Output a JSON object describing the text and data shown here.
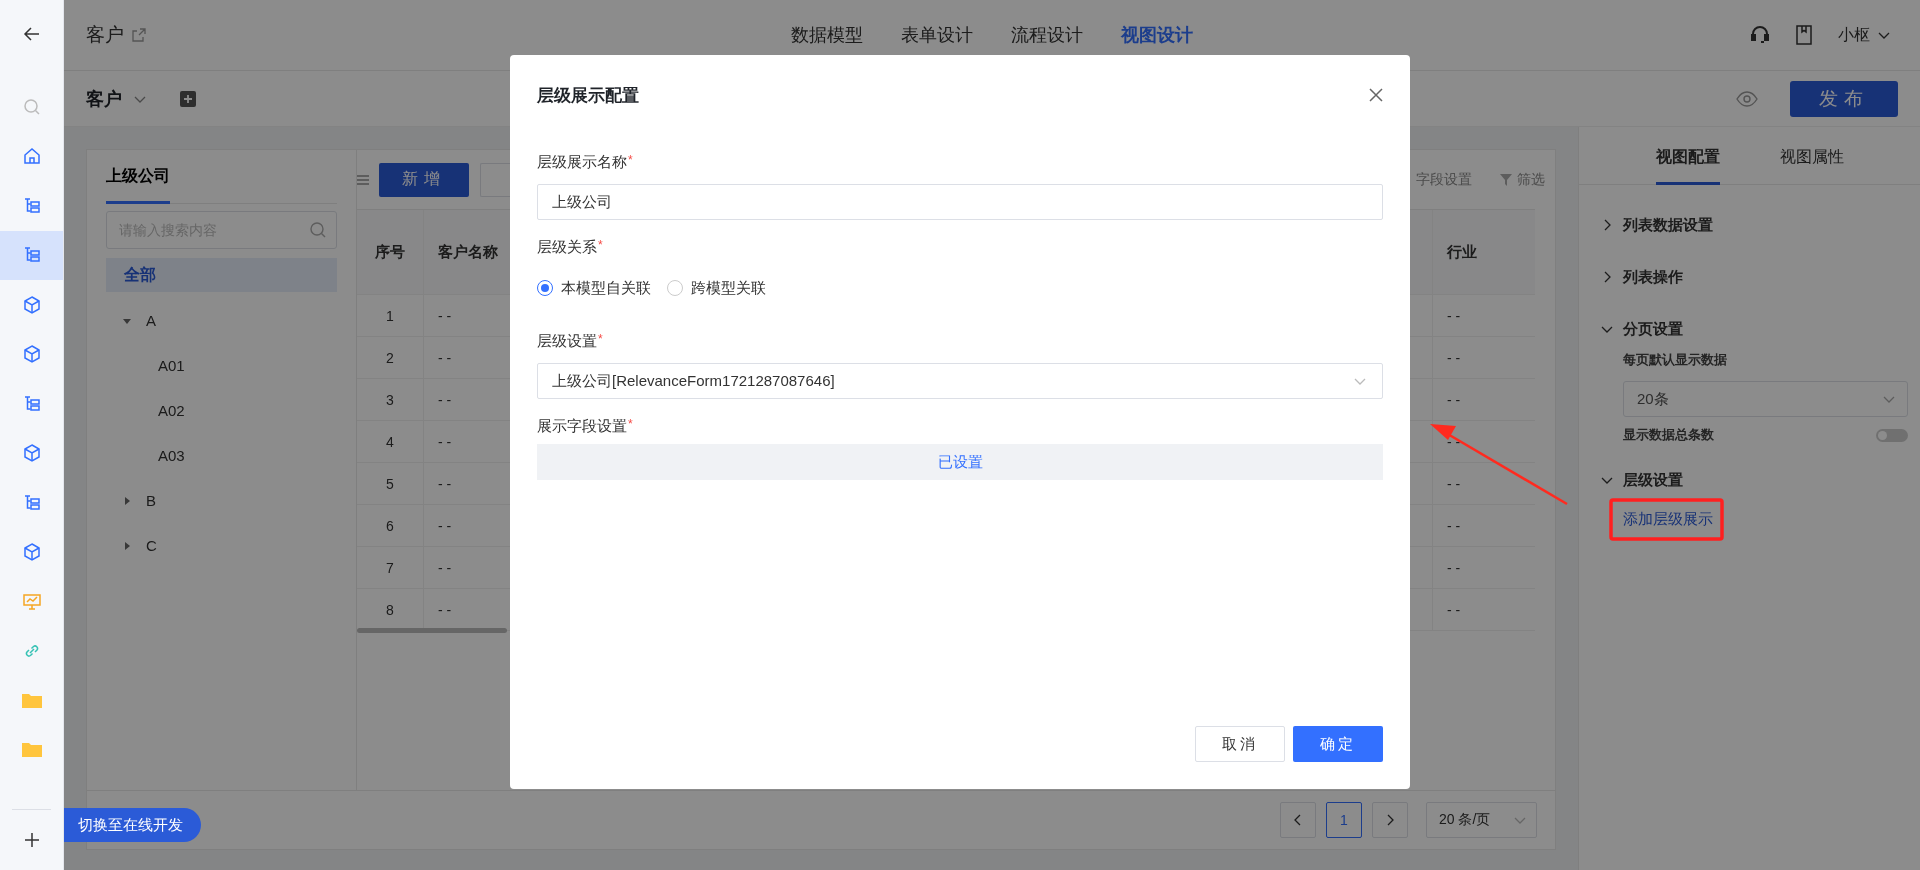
{
  "nav": {
    "items": [
      {
        "kind": "back",
        "selected": false
      },
      {
        "kind": "search",
        "selected": false
      },
      {
        "kind": "home",
        "selected": false
      },
      {
        "kind": "tree",
        "selected": false
      },
      {
        "kind": "tree",
        "selected": true
      },
      {
        "kind": "cube",
        "selected": false
      },
      {
        "kind": "cube",
        "selected": false
      },
      {
        "kind": "tree",
        "selected": false
      },
      {
        "kind": "cube",
        "selected": false
      },
      {
        "kind": "tree",
        "selected": false
      },
      {
        "kind": "cube",
        "selected": false
      },
      {
        "kind": "board",
        "selected": false
      },
      {
        "kind": "link",
        "selected": false
      },
      {
        "kind": "folder",
        "selected": false
      },
      {
        "kind": "folder",
        "selected": false
      }
    ],
    "add": {
      "kind": "plus"
    }
  },
  "header": {
    "title": "客户",
    "tabs": [
      {
        "label": "数据模型",
        "selected": false
      },
      {
        "label": "表单设计",
        "selected": false
      },
      {
        "label": "流程设计",
        "selected": false
      },
      {
        "label": "视图设计",
        "selected": true
      }
    ],
    "user": "小枢"
  },
  "toolbar": {
    "view_name": "客户",
    "publish": "发布"
  },
  "tree_panel": {
    "tab": "上级公司",
    "search": {
      "placeholder": "请输入搜索内容"
    },
    "all": {
      "label": "全部",
      "selected": true
    },
    "nodes": [
      {
        "label": "A",
        "expanded": true,
        "selected": false,
        "children": [
          {
            "label": "A01",
            "selected": false
          },
          {
            "label": "A02",
            "selected": false
          },
          {
            "label": "A03",
            "selected": false
          }
        ]
      },
      {
        "label": "B",
        "expanded": false,
        "selected": false
      },
      {
        "label": "C",
        "expanded": false,
        "selected": false
      }
    ]
  },
  "table": {
    "add_button": "新增",
    "field_settings": "字段设置",
    "filter": "筛选",
    "columns": [
      "序号",
      "客户名称",
      "行业"
    ],
    "rows": [
      {
        "index": "1",
        "name": "- -",
        "industry": "- -"
      },
      {
        "index": "2",
        "name": "- -",
        "industry": "- -"
      },
      {
        "index": "3",
        "name": "- -",
        "industry": "- -"
      },
      {
        "index": "4",
        "name": "- -",
        "industry": "- -"
      },
      {
        "index": "5",
        "name": "- -",
        "industry": "- -"
      },
      {
        "index": "6",
        "name": "- -",
        "industry": "- -"
      },
      {
        "index": "7",
        "name": "- -",
        "industry": "- -"
      },
      {
        "index": "8",
        "name": "- -",
        "industry": "- -"
      }
    ]
  },
  "pagination": {
    "page": "1",
    "page_size": "20 条/页"
  },
  "switch_button": "切换至在线开发",
  "right_panel": {
    "tabs": [
      {
        "label": "视图配置",
        "selected": true
      },
      {
        "label": "视图属性",
        "selected": false
      }
    ],
    "sections": [
      {
        "title": "列表数据设置",
        "expanded": false
      },
      {
        "title": "列表操作",
        "expanded": false
      },
      {
        "title": "分页设置",
        "expanded": true,
        "page_size_label": "每页默认显示数据",
        "page_size": "20条",
        "total_label": "显示数据总条数",
        "show_total": false
      },
      {
        "title": "层级设置",
        "expanded": true,
        "link": "添加层级展示"
      }
    ]
  },
  "dialog": {
    "title": "层级展示配置",
    "fields": [
      {
        "kind": "text",
        "label": "层级展示名称",
        "required_mark": "*",
        "value": "上级公司"
      },
      {
        "kind": "radio",
        "label": "层级关系",
        "required_mark": "*",
        "options": [
          {
            "label": "本模型自关联",
            "selected": true
          },
          {
            "label": "跨模型关联",
            "selected": false
          }
        ]
      },
      {
        "kind": "select",
        "label": "层级设置",
        "required_mark": "*",
        "value": "上级公司[RelevanceForm1721287087646]"
      },
      {
        "kind": "button",
        "label": "展示字段设置",
        "required_mark": "*",
        "button": "已设置"
      }
    ],
    "buttons": [
      {
        "label": "取消",
        "kind": "secondary"
      },
      {
        "label": "确定",
        "kind": "primary"
      }
    ]
  }
}
